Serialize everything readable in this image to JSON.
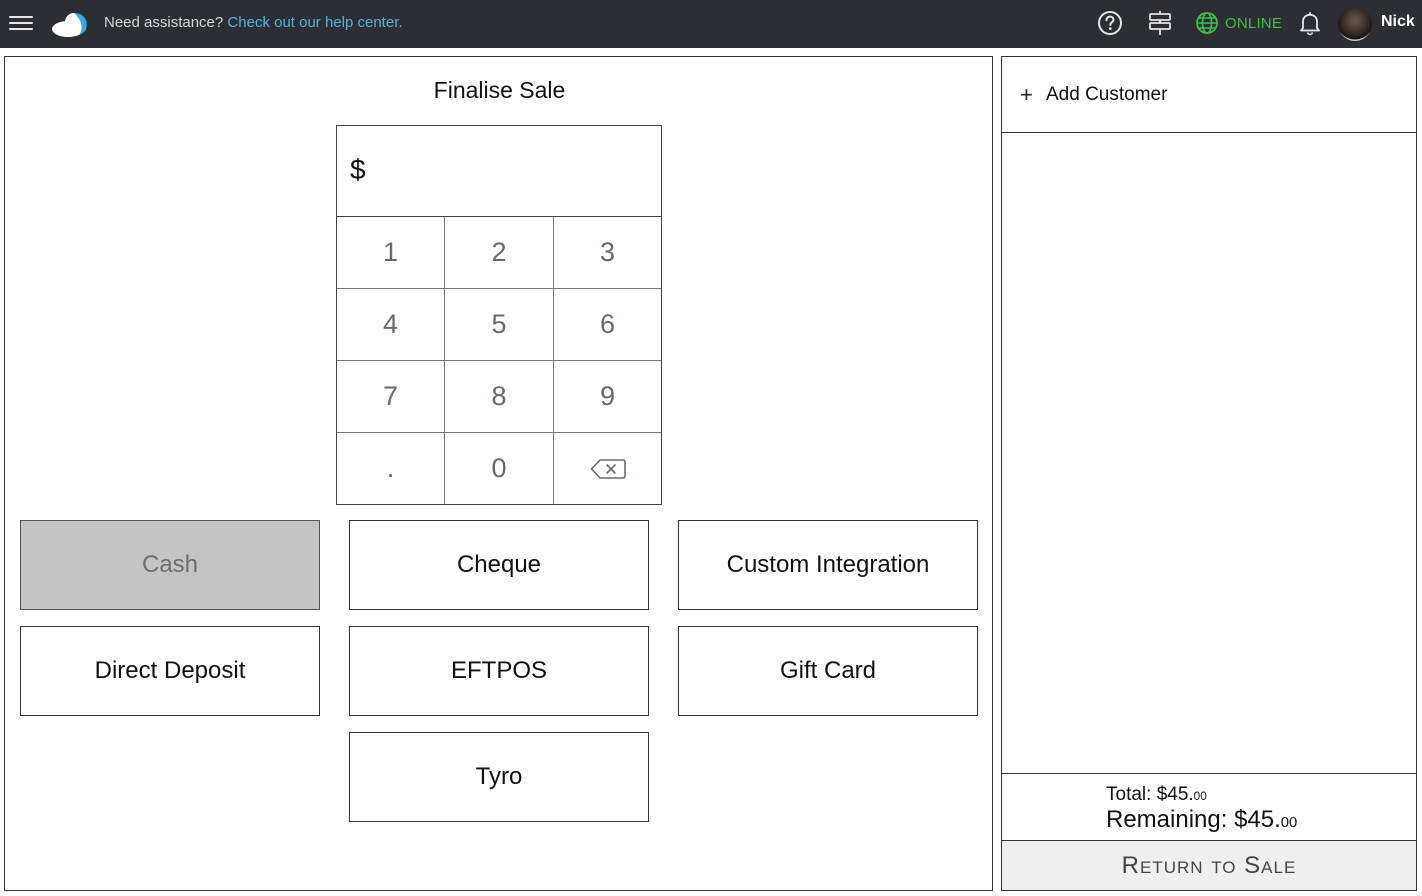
{
  "topbar": {
    "help_prefix": "Need assistance?",
    "help_link": "Check out our help center.",
    "status": "ONLINE",
    "status_color": "#3fbf4a",
    "user_name": "Nick",
    "icons": [
      "menu-icon",
      "cloud-logo-icon",
      "help-circle-icon",
      "signpost-icon",
      "globe-icon",
      "bell-icon"
    ]
  },
  "sale": {
    "title": "Finalise Sale",
    "currency": "$",
    "amount_value": ""
  },
  "keypad": {
    "k1": "1",
    "k2": "2",
    "k3": "3",
    "k4": "4",
    "k5": "5",
    "k6": "6",
    "k7": "7",
    "k8": "8",
    "k9": "9",
    "kdot": ".",
    "k0": "0",
    "backspace_icon": "backspace-icon"
  },
  "payment_methods": {
    "cash": "Cash",
    "cheque": "Cheque",
    "custom_integration": "Custom Integration",
    "direct_deposit": "Direct Deposit",
    "eftpos": "EFTPOS",
    "gift_card": "Gift Card",
    "tyro": "Tyro",
    "selected": "Cash"
  },
  "customer": {
    "add_label": "Add Customer"
  },
  "totals": {
    "total_label": "Total: $45.",
    "total_cents": "00",
    "remaining_label": "Remaining: $45.",
    "remaining_cents": "00"
  },
  "return_label": "Return to Sale"
}
